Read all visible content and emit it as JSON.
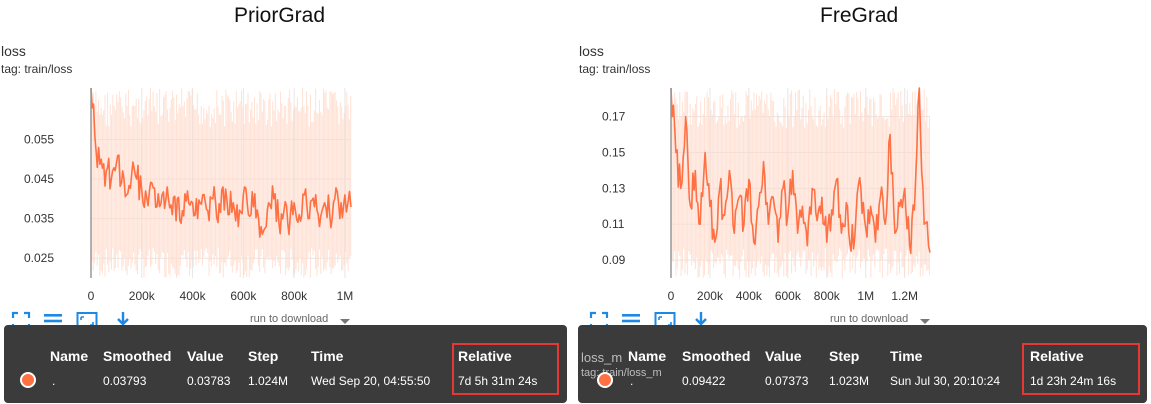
{
  "panels": {
    "left": {
      "heading": "PriorGrad",
      "card_title": "loss",
      "card_tag": "tag: train/loss",
      "run_to_download": "run to download",
      "tooltip": {
        "headers": [
          "Name",
          "Smoothed",
          "Value",
          "Step",
          "Time",
          "Relative"
        ],
        "row": {
          "name": ".",
          "smoothed": "0.03793",
          "value": "0.03783",
          "step": "1.024M",
          "time": "Wed Sep 20, 04:55:50",
          "relative": "7d 5h 31m 24s"
        }
      }
    },
    "right": {
      "heading": "FreGrad",
      "card_title": "loss",
      "card_tag": "tag: train/loss",
      "run_to_download": "run to download",
      "tooltip": {
        "headers": [
          "Name",
          "Smoothed",
          "Value",
          "Step",
          "Time",
          "Relative"
        ],
        "row": {
          "name": ".",
          "smoothed": "0.09422",
          "value": "0.07373",
          "step": "1.023M",
          "time": "Sun Jul 30, 20:10:24",
          "relative": "1d 23h 24m 16s"
        }
      },
      "behind_tooltip": {
        "label1": "loss_m",
        "label2": "tag: train/loss_m"
      }
    }
  },
  "colors": {
    "smoothed": "#ff7043",
    "raw": "#ffd9cc",
    "tooltip_bg": "#3b3b3b",
    "highlight": "#e53935",
    "icon": "#1e88e5"
  },
  "chart_data": [
    {
      "type": "line",
      "title": "loss",
      "subtitle": "tag: train/loss",
      "x_range": [
        0,
        1024000
      ],
      "y_range": [
        0.02,
        0.068
      ],
      "x_ticks": [
        0,
        200000,
        400000,
        600000,
        800000,
        1000000
      ],
      "x_tick_labels": [
        "0",
        "200k",
        "400k",
        "600k",
        "800k",
        "1M"
      ],
      "y_ticks": [
        0.025,
        0.035,
        0.045,
        0.055
      ],
      "y_tick_labels": [
        "0.025",
        "0.035",
        "0.045",
        "0.055"
      ],
      "grid": true,
      "series": [
        {
          "values_x": [
            0,
            20000,
            40000,
            60000,
            80000,
            100000,
            120000,
            140000,
            160000,
            180000,
            200000,
            220000,
            240000,
            260000,
            280000,
            300000,
            320000,
            340000,
            360000,
            380000,
            400000,
            420000,
            440000,
            460000,
            480000,
            500000,
            520000,
            540000,
            560000,
            580000,
            600000,
            620000,
            640000,
            660000,
            680000,
            700000,
            720000,
            740000,
            760000,
            780000,
            800000,
            820000,
            840000,
            860000,
            880000,
            900000,
            920000,
            940000,
            960000,
            980000,
            1000000,
            1024000
          ],
          "values_y": [
            0.068,
            0.052,
            0.05,
            0.047,
            0.045,
            0.049,
            0.044,
            0.041,
            0.046,
            0.045,
            0.042,
            0.04,
            0.044,
            0.038,
            0.041,
            0.043,
            0.036,
            0.04,
            0.037,
            0.042,
            0.039,
            0.035,
            0.041,
            0.037,
            0.04,
            0.034,
            0.043,
            0.036,
            0.039,
            0.033,
            0.041,
            0.036,
            0.038,
            0.035,
            0.032,
            0.039,
            0.04,
            0.034,
            0.037,
            0.031,
            0.039,
            0.036,
            0.041,
            0.035,
            0.038,
            0.033,
            0.039,
            0.036,
            0.04,
            0.035,
            0.041,
            0.03793
          ]
        }
      ]
    },
    {
      "type": "line",
      "title": "loss",
      "subtitle": "tag: train/loss",
      "x_range": [
        0,
        1330000
      ],
      "y_range": [
        0.08,
        0.186
      ],
      "x_ticks": [
        0,
        200000,
        400000,
        600000,
        800000,
        1000000,
        1200000
      ],
      "x_tick_labels": [
        "0",
        "200k",
        "400k",
        "600k",
        "800k",
        "1M",
        "1.2M"
      ],
      "y_ticks": [
        0.09,
        0.11,
        0.13,
        0.15,
        0.17
      ],
      "y_tick_labels": [
        "0.09",
        "0.11",
        "0.13",
        "0.15",
        "0.17"
      ],
      "grid": true,
      "series": [
        {
          "values_x": [
            0,
            25000,
            50000,
            75000,
            100000,
            125000,
            150000,
            175000,
            200000,
            225000,
            250000,
            275000,
            300000,
            325000,
            350000,
            375000,
            400000,
            425000,
            450000,
            475000,
            500000,
            525000,
            550000,
            575000,
            600000,
            625000,
            650000,
            675000,
            700000,
            725000,
            750000,
            775000,
            800000,
            825000,
            850000,
            875000,
            900000,
            925000,
            950000,
            975000,
            1000000,
            1025000,
            1050000,
            1075000,
            1100000,
            1125000,
            1150000,
            1175000,
            1200000,
            1225000,
            1250000,
            1275000,
            1300000,
            1330000
          ],
          "values_y": [
            0.186,
            0.15,
            0.13,
            0.17,
            0.12,
            0.14,
            0.11,
            0.15,
            0.12,
            0.1,
            0.13,
            0.115,
            0.14,
            0.105,
            0.125,
            0.11,
            0.135,
            0.1,
            0.12,
            0.145,
            0.11,
            0.125,
            0.1,
            0.13,
            0.115,
            0.14,
            0.105,
            0.12,
            0.098,
            0.13,
            0.112,
            0.125,
            0.1,
            0.118,
            0.135,
            0.105,
            0.122,
            0.095,
            0.115,
            0.13,
            0.108,
            0.12,
            0.1,
            0.125,
            0.11,
            0.16,
            0.105,
            0.12,
            0.13,
            0.098,
            0.118,
            0.186,
            0.11,
            0.09422
          ]
        }
      ]
    }
  ]
}
